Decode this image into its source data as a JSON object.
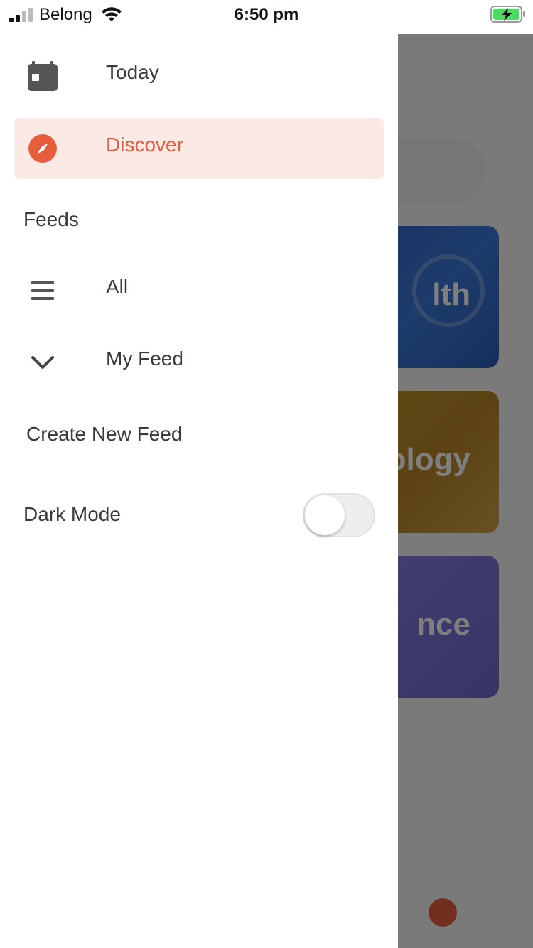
{
  "status_bar": {
    "carrier": "Belong",
    "time": "6:50 pm",
    "signal_icon": "cellular-signal-icon",
    "wifi_icon": "wifi-icon",
    "battery_icon": "battery-charging-icon"
  },
  "drawer": {
    "today_label": "Today",
    "discover_label": "Discover",
    "feeds_label": "Feeds",
    "all_label": "All",
    "my_feed_label": "My Feed",
    "create_feed_label": "Create New Feed",
    "dark_mode_label": "Dark Mode",
    "dark_mode_on": false
  },
  "background": {
    "categories": [
      "lth",
      "ology",
      "nce"
    ]
  },
  "colors": {
    "accent": "#e55d3d",
    "active_bg": "#fbe9e6",
    "text": "#3a3a3a"
  }
}
